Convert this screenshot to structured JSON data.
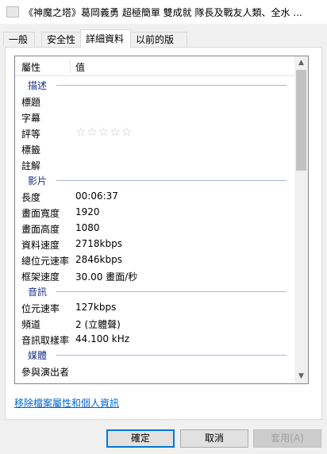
{
  "window": {
    "title": "《神魔之塔》葛岡義勇 超極簡單 雙成就 隊長及戰友人類、全水 ..."
  },
  "tabs": [
    {
      "label": "一般"
    },
    {
      "label": "安全性"
    },
    {
      "label": "詳細資料"
    },
    {
      "label": "以前的版本"
    }
  ],
  "list": {
    "header": {
      "property": "屬性",
      "value": "值"
    },
    "groups": {
      "description": "描述",
      "video": "影片",
      "audio": "音訊",
      "media": "媒體"
    },
    "rows": {
      "title": {
        "name": "標題",
        "value": ""
      },
      "subtitle": {
        "name": "字幕",
        "value": ""
      },
      "rating": {
        "name": "評等",
        "stars": "☆☆☆☆☆"
      },
      "tags": {
        "name": "標籤",
        "value": ""
      },
      "comments": {
        "name": "註解",
        "value": ""
      },
      "length": {
        "name": "長度",
        "value": "00:06:37"
      },
      "frame_width": {
        "name": "畫面寬度",
        "value": "1920"
      },
      "frame_height": {
        "name": "畫面高度",
        "value": "1080"
      },
      "data_rate": {
        "name": "資料速度",
        "value": "2718kbps"
      },
      "total_bitrate": {
        "name": "總位元速率",
        "value": "2846kbps"
      },
      "frame_rate": {
        "name": "框架速度",
        "value": "30.00 畫面/秒"
      },
      "audio_bitrate": {
        "name": "位元速率",
        "value": "127kbps"
      },
      "channels": {
        "name": "頻道",
        "value": "2 (立體聲)"
      },
      "sample_rate": {
        "name": "音訊取樣率",
        "value": "44.100 kHz"
      },
      "contributing_artists": {
        "name": "參與演出者",
        "value": ""
      }
    }
  },
  "link": {
    "remove_properties": "移除檔案屬性和個人資訊"
  },
  "buttons": {
    "ok": "確定",
    "cancel": "取消",
    "apply": "套用(A)"
  }
}
